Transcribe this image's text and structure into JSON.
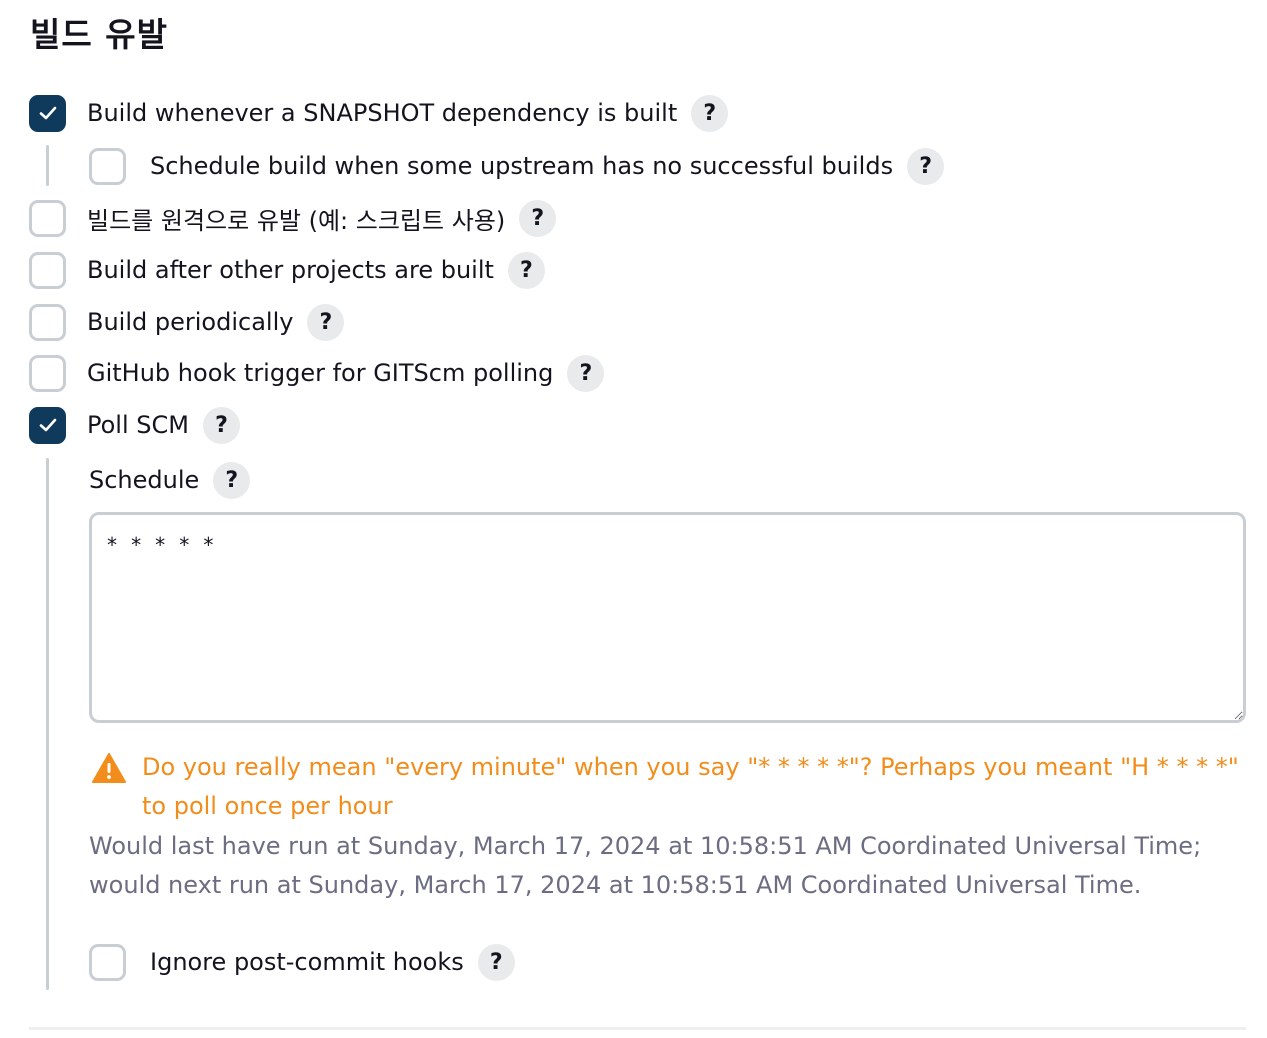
{
  "section": {
    "title": "빌드 유발"
  },
  "triggers": {
    "snapshot": {
      "label": "Build whenever a SNAPSHOT dependency is built",
      "checked": true
    },
    "upstream": {
      "label": "Schedule build when some upstream has no successful builds",
      "checked": false
    },
    "remote": {
      "label": "빌드를 원격으로 유발 (예: 스크립트 사용)",
      "checked": false
    },
    "after_other": {
      "label": "Build after other projects are built",
      "checked": false
    },
    "periodic": {
      "label": "Build periodically",
      "checked": false
    },
    "github_hook": {
      "label": "GitHub hook trigger for GITScm polling",
      "checked": false
    },
    "poll_scm": {
      "label": "Poll SCM",
      "checked": true
    },
    "ignore_hooks": {
      "label": "Ignore post-commit hooks",
      "checked": false
    }
  },
  "help": {
    "glyph": "?"
  },
  "schedule": {
    "label": "Schedule",
    "value": "* * * * *"
  },
  "warning": {
    "text": "Do you really mean \"every minute\" when you say \"* * * * *\"? Perhaps you meant \"H * * * *\" to poll once per hour"
  },
  "info": {
    "text": "Would last have run at Sunday, March 17, 2024 at 10:58:51 AM Coordinated Universal Time; would next run at Sunday, March 17, 2024 at 10:58:51 AM Coordinated Universal Time."
  },
  "colors": {
    "checkbox_checked": "#0f3a5c",
    "checkbox_border": "#c9ced4",
    "warning": "#f28c1a",
    "info_text": "#6c6c82",
    "help_bg": "#e9eaec"
  }
}
